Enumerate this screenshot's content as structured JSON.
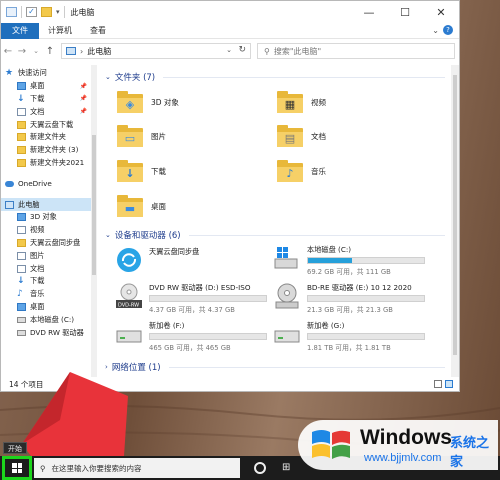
{
  "window": {
    "title": "此电脑",
    "ribbon_tabs": [
      "文件",
      "计算机",
      "查看"
    ],
    "address_path": "此电脑",
    "search_placeholder": "搜索\"此电脑\"",
    "status": "14 个项目"
  },
  "nav": {
    "quick_access": "快速访问",
    "items": [
      {
        "label": "桌面",
        "icon": "desktop-icon",
        "pinned": true
      },
      {
        "label": "下载",
        "icon": "download-icon",
        "pinned": true
      },
      {
        "label": "文档",
        "icon": "document-icon",
        "pinned": true
      },
      {
        "label": "天翼云盘下载",
        "icon": "folder-icon"
      },
      {
        "label": "新建文件夹",
        "icon": "folder-icon"
      },
      {
        "label": "新建文件夹 (3)",
        "icon": "folder-icon"
      },
      {
        "label": "新建文件夹2021",
        "icon": "folder-icon"
      }
    ],
    "onedrive": "OneDrive",
    "this_pc": "此电脑",
    "pc_items": [
      {
        "label": "3D 对象",
        "icon": "3d-objects-icon"
      },
      {
        "label": "视频",
        "icon": "video-icon"
      },
      {
        "label": "天翼云盘同步盘",
        "icon": "cloud-sync-icon"
      },
      {
        "label": "图片",
        "icon": "picture-icon"
      },
      {
        "label": "文档",
        "icon": "document-icon"
      },
      {
        "label": "下载",
        "icon": "download-icon"
      },
      {
        "label": "音乐",
        "icon": "music-icon"
      },
      {
        "label": "桌面",
        "icon": "desktop-icon"
      },
      {
        "label": "本地磁盘 (C:)",
        "icon": "drive-icon"
      },
      {
        "label": "DVD RW 驱动器",
        "icon": "dvd-icon"
      }
    ]
  },
  "content": {
    "folders_header": "文件夹 (7)",
    "folders": [
      {
        "label": "3D 对象",
        "glyph": "3d-icon"
      },
      {
        "label": "视频",
        "glyph": "film-icon"
      },
      {
        "label": "图片",
        "glyph": "picture-icon"
      },
      {
        "label": "文档",
        "glyph": "document-icon"
      },
      {
        "label": "下载",
        "glyph": "download-arrow-icon"
      },
      {
        "label": "音乐",
        "glyph": "music-note-icon"
      },
      {
        "label": "桌面",
        "glyph": "desktop-icon"
      }
    ],
    "devices_header": "设备和驱动器 (6)",
    "devices": [
      {
        "name": "天翼云盘同步盘",
        "detail": "",
        "fill": null,
        "icon": "cloud-sync-icon"
      },
      {
        "name": "本地磁盘 (C:)",
        "detail": "69.2 GB 可用，共 111 GB",
        "fill": 0.38,
        "icon": "windows-drive-icon"
      },
      {
        "name": "DVD RW 驱动器 (D:) ESD-ISO",
        "detail": "4.37 GB 可用，共 4.37 GB",
        "fill": 0.0,
        "icon": "dvd-drive-icon"
      },
      {
        "name": "BD-RE 驱动器 (E:) 10 12 2020",
        "detail": "21.3 GB 可用，共 21.3 GB",
        "fill": 0.0,
        "icon": "bd-drive-icon"
      },
      {
        "name": "新加卷 (F:)",
        "detail": "465 GB 可用，共 465 GB",
        "fill": 0.0,
        "icon": "drive-icon"
      },
      {
        "name": "新加卷 (G:)",
        "detail": "1.81 TB 可用，共 1.81 TB",
        "fill": 0.0,
        "icon": "drive-icon"
      }
    ],
    "network_header": "网络位置 (1)"
  },
  "taskbar": {
    "start_tooltip": "开始",
    "search_placeholder": "在这里输入你要搜索的内容"
  },
  "watermark": {
    "brand": "Windows",
    "brand_cn": "系统之家",
    "url": "www.bjjmlv.com"
  },
  "colors": {
    "accent": "#1f6fbd",
    "drive_fill": "#26a0da",
    "start_highlight": "#1cd51c",
    "arrow": "#e8333a"
  }
}
